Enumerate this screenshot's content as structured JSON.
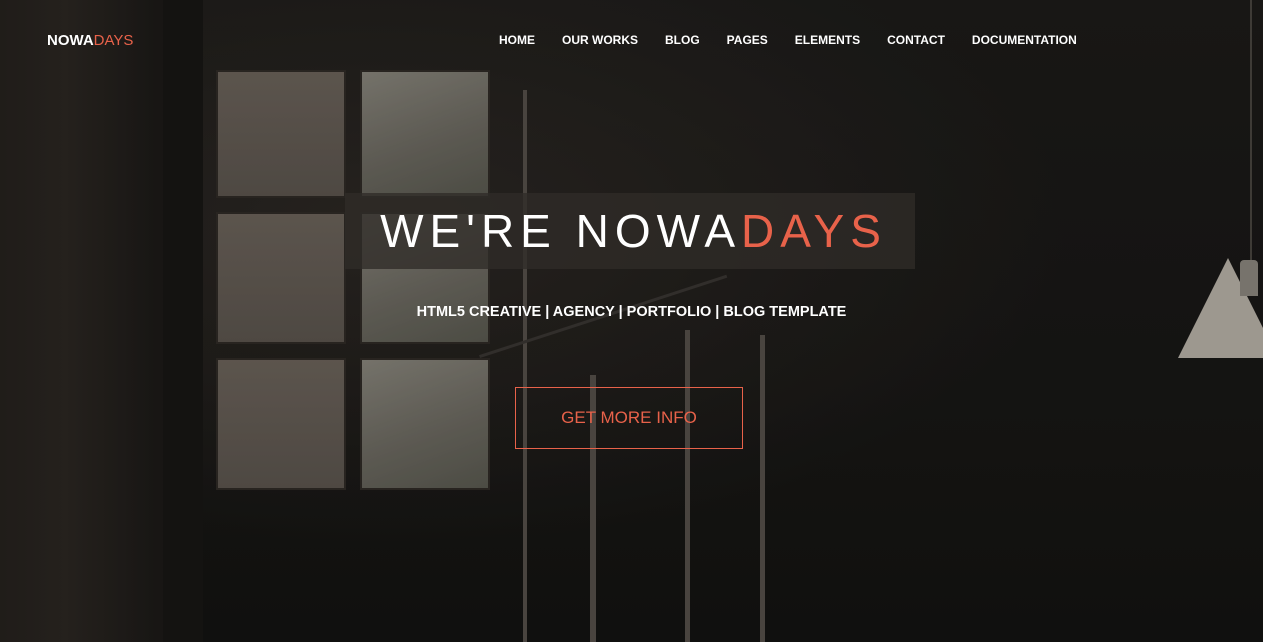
{
  "brand": {
    "logo_main": "NOWA",
    "logo_accent": "DAYS",
    "accent_color": "#e8624a"
  },
  "nav": {
    "items": [
      {
        "label": "HOME"
      },
      {
        "label": "OUR WORKS"
      },
      {
        "label": "BLOG"
      },
      {
        "label": "PAGES"
      },
      {
        "label": "ELEMENTS"
      },
      {
        "label": "CONTACT"
      },
      {
        "label": "DOCUMENTATION"
      }
    ]
  },
  "hero": {
    "headline_main": "WE'RE NOWA",
    "headline_accent": "DAYS",
    "subline": "HTML5 CREATIVE | AGENCY | PORTFOLIO | BLOG TEMPLATE",
    "cta_label": "GET MORE INFO"
  }
}
